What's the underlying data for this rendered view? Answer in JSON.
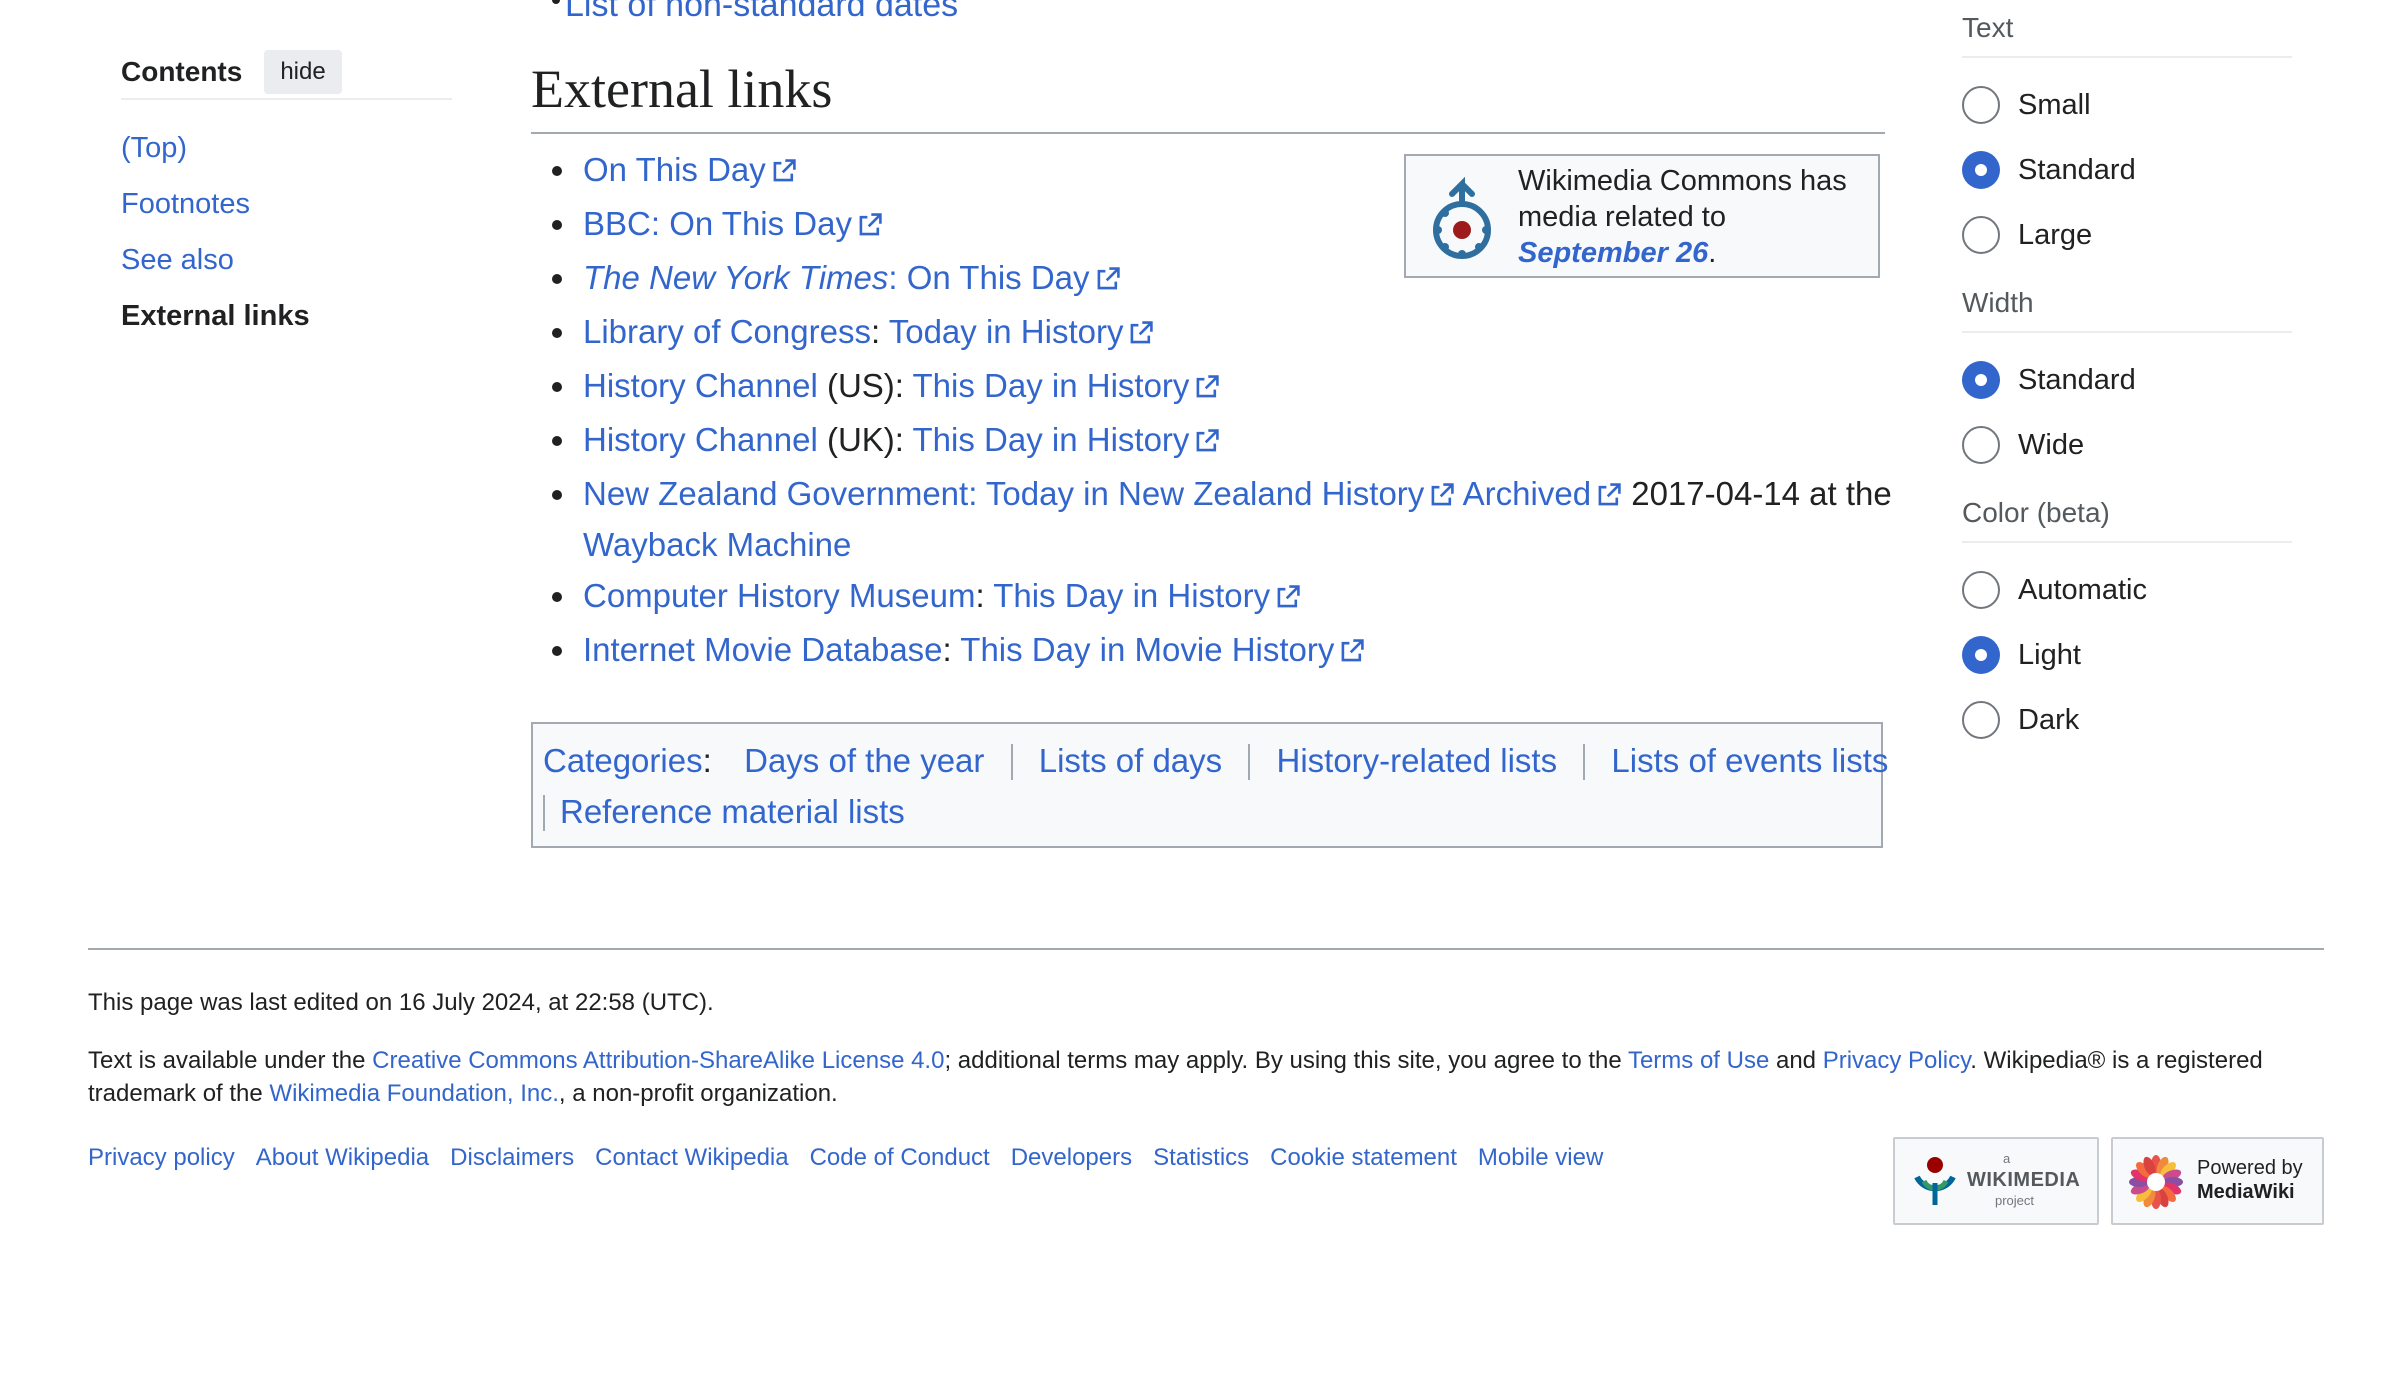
{
  "toc": {
    "title": "Contents",
    "hide_label": "hide",
    "items": [
      {
        "label": "(Top)"
      },
      {
        "label": "Footnotes"
      },
      {
        "label": "See also"
      },
      {
        "label": "External links"
      }
    ]
  },
  "main": {
    "cut_item": "List of non-standard dates",
    "heading": "External links",
    "links": [
      {
        "parts": [
          {
            "t": "On This Day",
            "link": true
          }
        ],
        "ext": true
      },
      {
        "parts": [
          {
            "t": "BBC: On This Day",
            "link": true
          }
        ],
        "ext": true
      },
      {
        "parts": [
          {
            "t": "The New York Times",
            "link": true,
            "italic": true
          },
          {
            "t": ": On This Day",
            "link": true
          }
        ],
        "ext": true
      },
      {
        "parts": [
          {
            "t": "Library of Congress",
            "link": true
          },
          {
            "t": ": "
          },
          {
            "t": "Today in History",
            "link": true
          }
        ],
        "ext": true
      },
      {
        "parts": [
          {
            "t": "History Channel",
            "link": true
          },
          {
            "t": " (US): "
          },
          {
            "t": "This Day in History",
            "link": true
          }
        ],
        "ext": true
      },
      {
        "parts": [
          {
            "t": "History Channel",
            "link": true
          },
          {
            "t": " (UK): "
          },
          {
            "t": "This Day in History",
            "link": true
          }
        ],
        "ext": true
      },
      {
        "parts": [
          {
            "t": "New Zealand Government: Today in New Zealand History",
            "link": true,
            "ext": true
          },
          {
            "t": " "
          },
          {
            "t": "Archived",
            "link": true,
            "ext": true
          },
          {
            "t": " 2017-04-14 at the"
          }
        ],
        "second_line": "Wayback Machine",
        "ext": false
      },
      {
        "parts": [
          {
            "t": "Computer History Museum",
            "link": true
          },
          {
            "t": ": "
          },
          {
            "t": "This Day in History",
            "link": true
          }
        ],
        "ext": true
      },
      {
        "parts": [
          {
            "t": "Internet Movie Database",
            "link": true
          },
          {
            "t": ": "
          },
          {
            "t": "This Day in Movie History",
            "link": true
          }
        ],
        "ext": true
      }
    ],
    "commons": {
      "text": "Wikimedia Commons has media related to",
      "link": "September 26",
      "end": "."
    },
    "categories": {
      "label": "Categories",
      "colon": ":",
      "row1": [
        "Days of the year",
        "Lists of days",
        "History-related lists",
        "Lists of events lists"
      ],
      "row2": [
        "Reference material lists"
      ]
    }
  },
  "appearance": {
    "groups": [
      {
        "title": "Text",
        "options": [
          {
            "label": "Small",
            "selected": false
          },
          {
            "label": "Standard",
            "selected": true
          },
          {
            "label": "Large",
            "selected": false
          }
        ]
      },
      {
        "title": "Width",
        "options": [
          {
            "label": "Standard",
            "selected": true
          },
          {
            "label": "Wide",
            "selected": false
          }
        ]
      },
      {
        "title": "Color (beta)",
        "options": [
          {
            "label": "Automatic",
            "selected": false
          },
          {
            "label": "Light",
            "selected": true
          },
          {
            "label": "Dark",
            "selected": false
          }
        ]
      }
    ]
  },
  "footer": {
    "last_edited": "This page was last edited on 16 July 2024, at 22:58 (UTC).",
    "license": {
      "p1": "Text is available under the ",
      "cc": "Creative Commons Attribution-ShareAlike License 4.0",
      "p2": "; additional terms may apply. By using this site, you agree to the ",
      "terms": "Terms of Use",
      "p3": " and ",
      "privacy": "Privacy Policy",
      "p4": ". Wikipedia® is a registered",
      "p5": "trademark of the ",
      "wmf": "Wikimedia Foundation, Inc.",
      "p6": ", a non-profit organization."
    },
    "places": [
      "Privacy policy",
      "About Wikipedia",
      "Disclaimers",
      "Contact Wikipedia",
      "Code of Conduct",
      "Developers",
      "Statistics",
      "Cookie statement",
      "Mobile view"
    ],
    "wmf_badge": {
      "small": "a",
      "big": "WIKIMEDIA",
      "sub": "project"
    },
    "mw_badge": {
      "top": "Powered by",
      "bottom": "MediaWiki"
    }
  }
}
